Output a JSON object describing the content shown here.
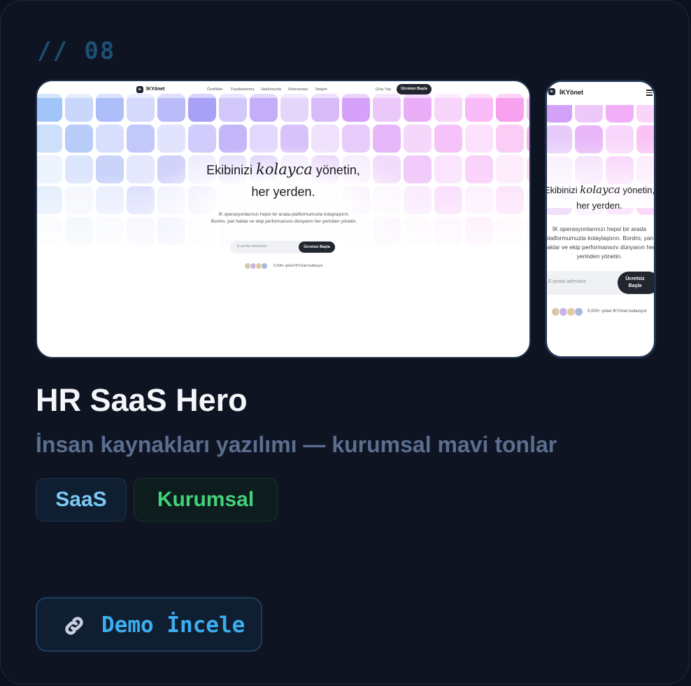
{
  "card": {
    "index": "// 08",
    "title": "HR SaaS Hero",
    "subtitle": "İnsan kaynakları yazılımı — kurumsal mavi tonlar",
    "tags": [
      "SaaS",
      "Kurumsal"
    ],
    "demo_label": "Demo İncele",
    "demo_icon": "link-icon",
    "colors": {
      "tag_saas": "#7cc8f5",
      "tag_corp": "#43d17a",
      "demo": "#3aaef0"
    }
  },
  "preview": {
    "logo_mark": "İK",
    "brand": "İKYönet",
    "nav_links": [
      "Özellikler",
      "Fiyatlandırma",
      "Hakkımızda",
      "Referanslar",
      "İletişim"
    ],
    "login": "Giriş Yap",
    "cta": "Ücretsiz Başla",
    "mobile_cta": "Ücretsiz Başla",
    "headline_pre": "Ekibinizi ",
    "headline_em": "kolayca",
    "headline_post": " yönetin,",
    "headline_line2": "her yerden.",
    "description": "İK operasyonlarınızı hepsi bir arada platformumuzla kolaylaştırın. Bordro, yan haklar ve ekip performansını dünyanın her yerinden yönetin.",
    "email_placeholder": "E-posta adresiniz",
    "social_proof": "5.000+ şirket İKYönet kullanıyor"
  }
}
